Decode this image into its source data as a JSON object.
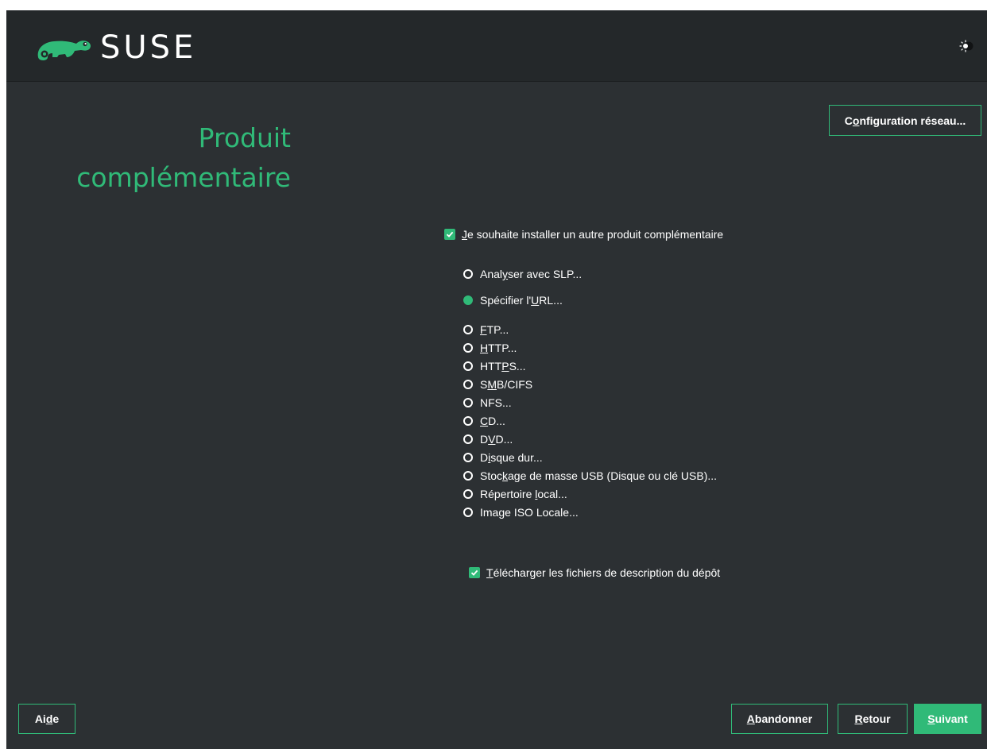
{
  "header": {
    "logo_text": "SUSE",
    "theme_toggle_icon": "sun-moon-icon"
  },
  "network_button": {
    "pre": "C",
    "key": "o",
    "post": "nfiguration réseau..."
  },
  "title": {
    "line1": "Produit",
    "line2": "complémentaire"
  },
  "main_checkbox": {
    "checked": true,
    "pre": "",
    "key": "J",
    "post": "e souhaite installer un autre produit complémentaire"
  },
  "radio_options": [
    {
      "pre": "Anal",
      "key": "y",
      "post": "ser avec SLP...",
      "selected": false
    },
    {
      "pre": "Spécifier l'",
      "key": "U",
      "post": "RL...",
      "selected": true
    },
    {
      "pre": "",
      "key": "F",
      "post": "TP...",
      "selected": false
    },
    {
      "pre": "",
      "key": "H",
      "post": "TTP...",
      "selected": false
    },
    {
      "pre": "HTT",
      "key": "P",
      "post": "S...",
      "selected": false
    },
    {
      "pre": "S",
      "key": "M",
      "post": "B/CIFS",
      "selected": false
    },
    {
      "pre": "NFS...",
      "key": "",
      "post": "",
      "selected": false
    },
    {
      "pre": "",
      "key": "C",
      "post": "D...",
      "selected": false
    },
    {
      "pre": "D",
      "key": "V",
      "post": "D...",
      "selected": false
    },
    {
      "pre": "D",
      "key": "i",
      "post": "sque dur...",
      "selected": false
    },
    {
      "pre": "Stoc",
      "key": "k",
      "post": "age de masse USB (Disque ou clé USB)...",
      "selected": false
    },
    {
      "pre": "Répertoire ",
      "key": "l",
      "post": "ocal...",
      "selected": false
    },
    {
      "pre": "Ima",
      "key": "g",
      "post": "e ISO Locale...",
      "selected": false
    }
  ],
  "download_checkbox": {
    "checked": true,
    "pre": "",
    "key": "T",
    "post": "élécharger les fichiers de description du dépôt"
  },
  "footer": {
    "help": {
      "pre": "Ai",
      "key": "d",
      "post": "e"
    },
    "abort": {
      "pre": "",
      "key": "A",
      "post": "bandonner"
    },
    "back": {
      "pre": "",
      "key": "R",
      "post": "etour"
    },
    "next": {
      "pre": "",
      "key": "S",
      "post": "uivant"
    }
  },
  "colors": {
    "accent": "#30ba78",
    "background": "#2c3033",
    "topbar": "#24282a"
  }
}
